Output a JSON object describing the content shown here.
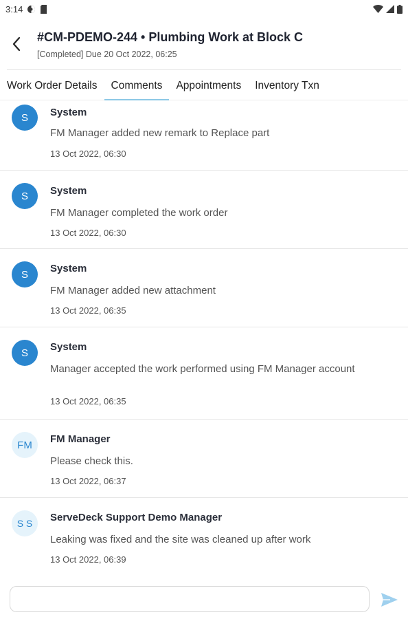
{
  "status_bar": {
    "time": "3:14"
  },
  "header": {
    "title": "#CM-PDEMO-244 • Plumbing Work at Block C",
    "subtitle": "[Completed] Due 20 Oct 2022, 06:25"
  },
  "tabs": [
    {
      "label": "Work Order Details",
      "active": false
    },
    {
      "label": "Comments",
      "active": true
    },
    {
      "label": "Appointments",
      "active": false
    },
    {
      "label": "Inventory Txn",
      "active": false
    }
  ],
  "comments": [
    {
      "avatar": "S",
      "author": "System",
      "text": "FM Manager added new remark to Replace part",
      "time": "13 Oct 2022, 06:30"
    },
    {
      "avatar": "S",
      "author": "System",
      "text": "FM Manager completed the work order",
      "time": "13 Oct 2022, 06:30"
    },
    {
      "avatar": "S",
      "author": "System",
      "text": "FM Manager added new attachment",
      "time": "13 Oct 2022, 06:35"
    },
    {
      "avatar": "S",
      "author": "System",
      "text": "Manager accepted the work performed using FM Manager account",
      "time": "13 Oct 2022, 06:35"
    },
    {
      "avatar": "FM",
      "author": "FM Manager",
      "text": "Please check this.",
      "time": "13 Oct 2022, 06:37"
    },
    {
      "avatar": "S S",
      "author": "ServeDeck Support Demo Manager",
      "text": "Leaking was fixed and the site was cleaned up after work",
      "time": "13 Oct 2022, 06:39"
    }
  ],
  "composer": {
    "value": "",
    "placeholder": ""
  },
  "colors": {
    "accent": "#2a86cf",
    "tab_indicator": "#8cc8e6",
    "avatar_light_bg": "#e5f3fb",
    "send_icon": "#9fd0ee"
  },
  "icons": {
    "back": "chevron-left-icon",
    "send": "send-icon",
    "wifi": "wifi-icon",
    "signal": "signal-icon",
    "battery": "battery-icon"
  }
}
